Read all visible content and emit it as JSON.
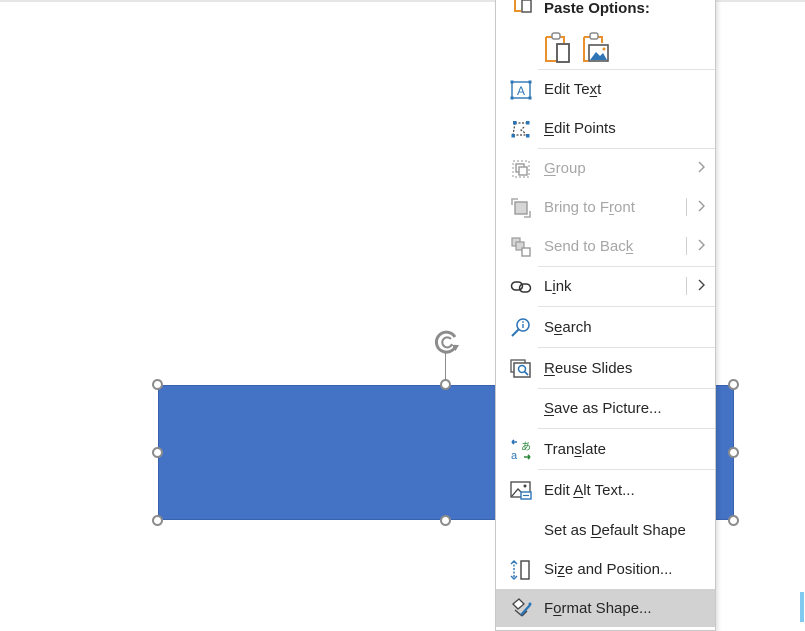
{
  "slide": {
    "shape_fill": "#4472c4",
    "shape_type": "rectangle"
  },
  "context_menu": {
    "paste_options": {
      "label": "Paste Options:",
      "options": [
        {
          "name": "keep-source-formatting",
          "icon": "clipboard-paste-icon"
        },
        {
          "name": "picture",
          "icon": "clipboard-picture-icon"
        }
      ]
    },
    "items": [
      {
        "pre": "Edit Te",
        "acc": "x",
        "post": "t",
        "icon": "edit-text-icon",
        "enabled": true,
        "submenu": false
      },
      {
        "pre": "",
        "acc": "E",
        "post": "dit Points",
        "icon": "edit-points-icon",
        "enabled": true,
        "submenu": false
      },
      {
        "pre": "",
        "acc": "G",
        "post": "roup",
        "icon": "group-icon",
        "enabled": false,
        "submenu": true
      },
      {
        "pre": "Bring to F",
        "acc": "r",
        "post": "ont",
        "icon": "bring-to-front-icon",
        "enabled": false,
        "submenu": true
      },
      {
        "pre": "Send to Bac",
        "acc": "k",
        "post": "",
        "icon": "send-to-back-icon",
        "enabled": false,
        "submenu": true
      },
      {
        "pre": "L",
        "acc": "i",
        "post": "nk",
        "icon": "link-icon",
        "enabled": true,
        "submenu": true
      },
      {
        "pre": "S",
        "acc": "e",
        "post": "arch",
        "icon": "search-icon",
        "enabled": true,
        "submenu": false
      },
      {
        "pre": "",
        "acc": "R",
        "post": "euse Slides",
        "icon": "reuse-slides-icon",
        "enabled": true,
        "submenu": false
      },
      {
        "pre": "",
        "acc": "S",
        "post": "ave as Picture...",
        "icon": "",
        "enabled": true,
        "submenu": false
      },
      {
        "pre": "Tran",
        "acc": "s",
        "post": "late",
        "icon": "translate-icon",
        "enabled": true,
        "submenu": false
      },
      {
        "pre": "Edit ",
        "acc": "A",
        "post": "lt Text...",
        "icon": "alt-text-icon",
        "enabled": true,
        "submenu": false
      },
      {
        "pre": "Set as ",
        "acc": "D",
        "post": "efault Shape",
        "icon": "",
        "enabled": true,
        "submenu": false
      },
      {
        "pre": "Si",
        "acc": "z",
        "post": "e and Position...",
        "icon": "size-position-icon",
        "enabled": true,
        "submenu": false
      },
      {
        "pre": "F",
        "acc": "o",
        "post": "rmat Shape...",
        "icon": "format-shape-icon",
        "enabled": true,
        "submenu": false,
        "highlighted": true
      }
    ]
  }
}
